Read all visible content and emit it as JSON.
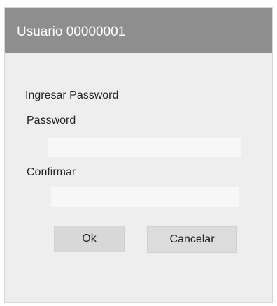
{
  "window": {
    "title": "Usuario 00000001"
  },
  "form": {
    "heading": "Ingresar Password",
    "password_label": "Password",
    "password_value": "",
    "confirm_label": "Confirmar",
    "confirm_value": ""
  },
  "buttons": {
    "ok_label": "Ok",
    "cancel_label": "Cancelar"
  },
  "colors": {
    "titlebar": "#8e8e8e",
    "panel": "#eeeeee",
    "field": "#f7f7f7",
    "button": "#dcdcdc"
  }
}
